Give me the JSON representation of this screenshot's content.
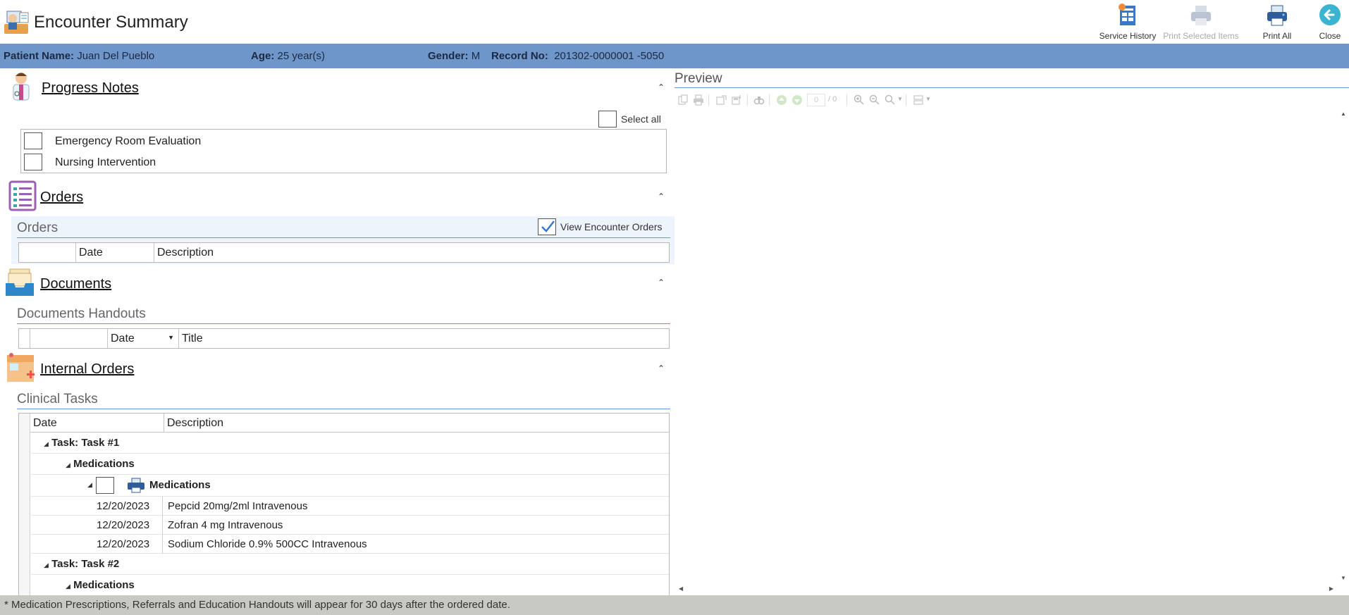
{
  "header": {
    "title": "Encounter Summary",
    "buttons": {
      "service_history": "Service History",
      "print_selected": "Print Selected Items",
      "print_all": "Print All",
      "close": "Close"
    }
  },
  "patient": {
    "name_label": "Patient Name:",
    "name": "Juan Del Pueblo",
    "age_label": "Age:",
    "age": "25 year(s)",
    "gender_label": "Gender:",
    "gender": "M",
    "record_label": "Record No:",
    "record": "201302-0000001 -5050"
  },
  "progress_notes": {
    "title": "Progress Notes",
    "select_all": "Select all",
    "items": [
      "Emergency Room Evaluation",
      "Nursing Intervention"
    ]
  },
  "orders": {
    "title": "Orders",
    "sub_title": "Orders",
    "view_encounter_orders": "View Encounter Orders",
    "view_encounter_orders_checked": true,
    "columns": [
      "Date",
      "Description"
    ]
  },
  "documents": {
    "title": "Documents",
    "sub_title": "Documents Handouts",
    "columns": [
      "Date",
      "Title"
    ]
  },
  "internal_orders": {
    "title": "Internal Orders",
    "sub_title": "Clinical Tasks",
    "columns": [
      "Date",
      "Description"
    ],
    "task1": "Task: Task #1",
    "task1_group": "Medications",
    "task1_subgroup": "Medications",
    "rows": [
      {
        "date": "12/20/2023",
        "description": "Pepcid 20mg/2ml  Intravenous"
      },
      {
        "date": "12/20/2023",
        "description": "Zofran 4 mg  Intravenous"
      },
      {
        "date": "12/20/2023",
        "description": "Sodium Chloride 0.9% 500CC  Intravenous"
      }
    ],
    "task2": "Task: Task #2",
    "task2_group": "Medications"
  },
  "preview": {
    "title": "Preview",
    "page_input": "0",
    "page_total": "/ 0"
  },
  "footer": {
    "note": "* Medication Prescriptions, Referrals and Education Handouts will appear for 30 days after the ordered date."
  },
  "colors": {
    "patient_bar": "#6f96c8",
    "accent": "#3aa0c8",
    "footer": "#c9c9c3"
  }
}
